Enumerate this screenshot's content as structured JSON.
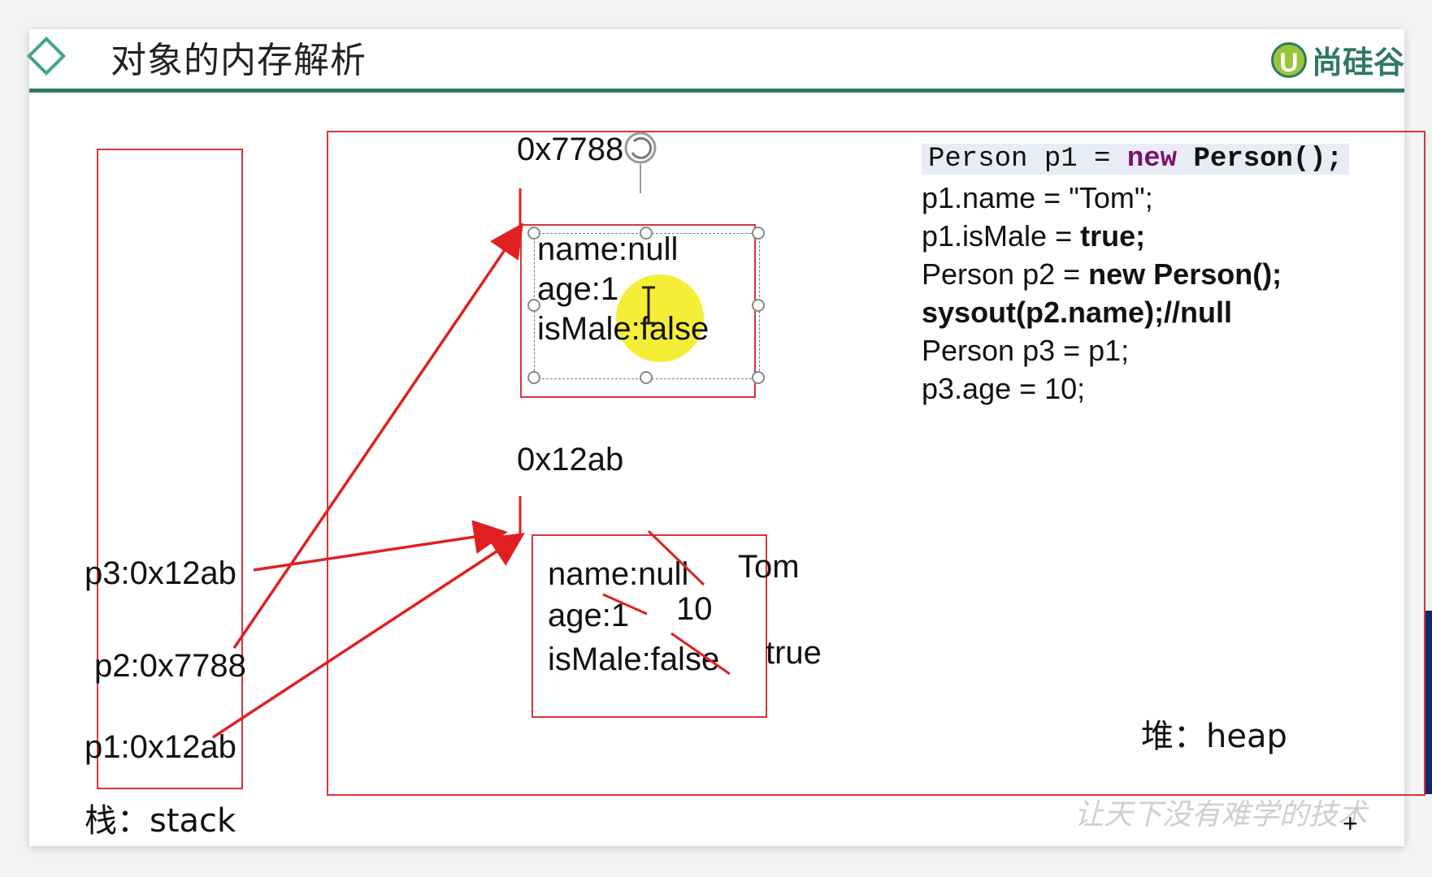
{
  "header": {
    "title": "对象的内存解析",
    "logo_mark": "U",
    "logo_text": "尚硅谷",
    "accent_color": "#2f7a61"
  },
  "heap": {
    "label": "堆：heap",
    "objects": [
      {
        "address": "0x7788",
        "fields": [
          "name:null",
          "age:1",
          "isMale:false"
        ]
      },
      {
        "address": "0x12ab",
        "fields": [
          "name:null",
          "age:1",
          "isMale:false"
        ],
        "updated_values": [
          "Tom",
          "10",
          "true"
        ]
      }
    ]
  },
  "stack": {
    "label": "栈：stack",
    "vars": [
      "p3:0x12ab",
      "p2:0x7788",
      "p1:0x12ab"
    ]
  },
  "code": {
    "line1": {
      "type": "Person",
      "var": "p1",
      "eq": "=",
      "kw": "new",
      "call": "Person();"
    },
    "line2": "p1.name = \"Tom\";",
    "line3_prefix": "p1.isMale = ",
    "line3_bold": "true;",
    "line4_prefix": "Person p2 = ",
    "line4_bold": "new Person();",
    "line5": "sysout(p2.name);//null",
    "line6": "Person p3 = p1;",
    "line7": "p3.age = 10;"
  },
  "watermark": "让天下没有难学的技术",
  "colors": {
    "box_border": "#d8343a",
    "arrow": "#e02020",
    "highlight": "#f2ec1b"
  }
}
